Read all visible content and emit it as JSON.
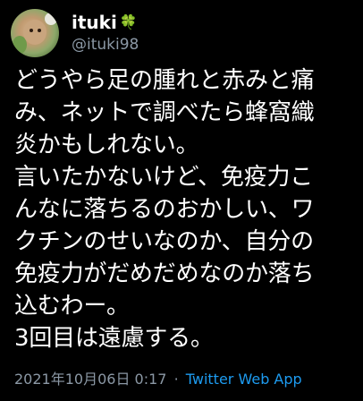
{
  "user": {
    "display_name": "ituki",
    "badge_icon": "four-leaf-clover-icon",
    "badge_glyph": "🍀",
    "handle": "@ituki98"
  },
  "tweet": {
    "lines": [
      "どうやら足の腫れと赤みと痛",
      "み、ネットで調べたら蜂窩織",
      "炎かもしれない。",
      "言いたかないけど、免疫力こ",
      "んなに落ちるのおかしい、ワ",
      "クチンのせいなのか、自分の",
      "免疫力がだめだめなのか落ち",
      "込むわー。",
      "3回目は遠慮する。"
    ],
    "timestamp": "2021年10月06日 0:17",
    "separator": "·",
    "source": "Twitter Web App"
  },
  "colors": {
    "background": "#000000",
    "text": "#ffffff",
    "secondary": "#8b98a5",
    "link": "#1d9bf0"
  }
}
